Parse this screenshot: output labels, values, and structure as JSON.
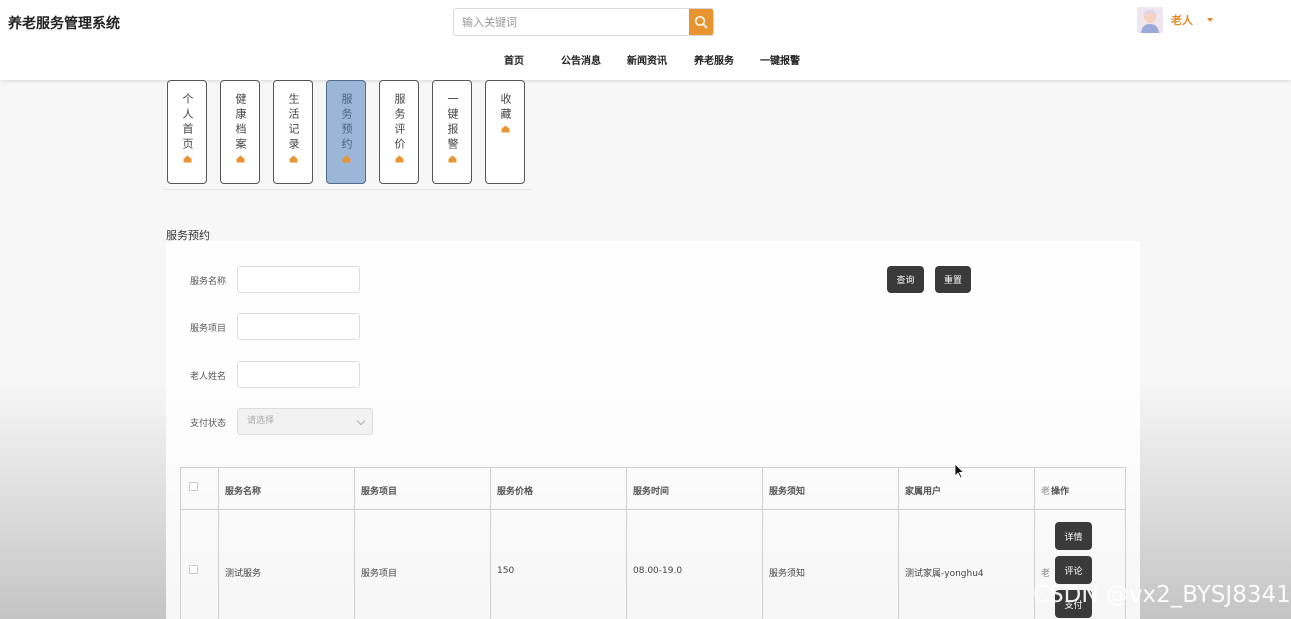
{
  "header": {
    "app_title": "养老服务管理系统",
    "search_placeholder": "输入关键词",
    "user_name": "老人"
  },
  "nav": [
    {
      "label": "首页"
    },
    {
      "label": "公告消息"
    },
    {
      "label": "新闻资讯"
    },
    {
      "label": "养老服务"
    },
    {
      "label": "一键报警"
    }
  ],
  "tabs": [
    {
      "label": "个人首页",
      "active": false
    },
    {
      "label": "健康档案",
      "active": false
    },
    {
      "label": "生活记录",
      "active": false
    },
    {
      "label": "服务预约",
      "active": true
    },
    {
      "label": "服务评价",
      "active": false
    },
    {
      "label": "一键报警",
      "active": false
    },
    {
      "label": "收藏",
      "active": false
    }
  ],
  "section_title": "服务预约",
  "search_form": {
    "service_name_label": "服务名称",
    "service_item_label": "服务项目",
    "elder_name_label": "老人姓名",
    "pay_status_label": "支付状态",
    "pay_status_placeholder": "请选择",
    "query_button": "查询",
    "reset_button": "重置"
  },
  "table": {
    "columns": [
      "服务名称",
      "服务项目",
      "服务价格",
      "服务时间",
      "服务须知",
      "家属用户",
      "老",
      "操作"
    ],
    "rows": [
      {
        "service_name": "测试服务",
        "service_item": "服务项目",
        "price": "150",
        "time": "08.00-19.0",
        "notice": "服务须知",
        "family_user": "测试家属-yonghu4",
        "elder": "老",
        "actions": [
          "详情",
          "评论",
          "支付"
        ]
      }
    ]
  },
  "watermark": "CSDN @vx2_BYSJ8341",
  "colors": {
    "accent_orange": "#e89431",
    "active_tab_bg": "#9cb6d8",
    "dark_button": "#3a3a3a"
  }
}
